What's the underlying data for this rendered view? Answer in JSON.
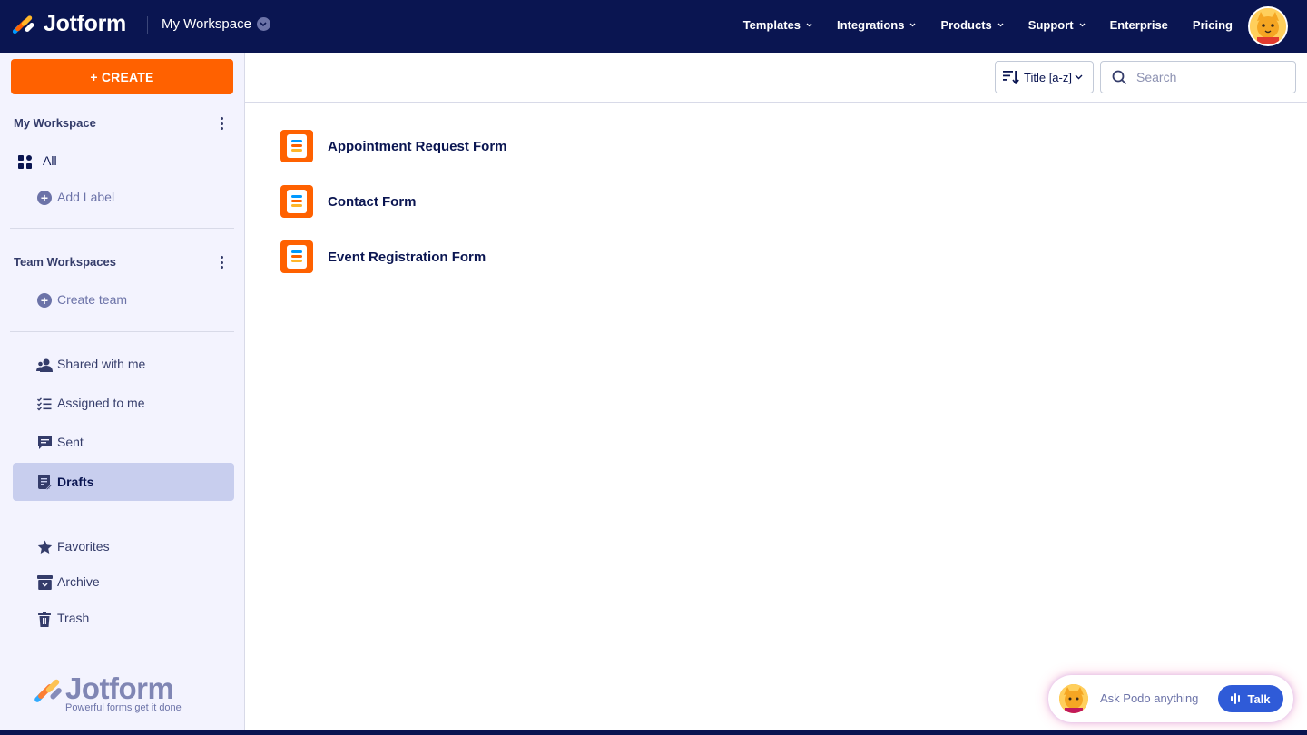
{
  "brand": {
    "name": "Jotform",
    "tagline": "Powerful forms get it done"
  },
  "header": {
    "workspace_switch": "My Workspace",
    "nav": [
      {
        "label": "Templates",
        "has_menu": true
      },
      {
        "label": "Integrations",
        "has_menu": true
      },
      {
        "label": "Products",
        "has_menu": true
      },
      {
        "label": "Support",
        "has_menu": true
      },
      {
        "label": "Enterprise",
        "has_menu": false
      },
      {
        "label": "Pricing",
        "has_menu": false
      }
    ]
  },
  "sidebar": {
    "create_label": "+ CREATE",
    "my_workspace": {
      "title": "My Workspace",
      "items": [
        {
          "label": "All",
          "icon": "grid-icon"
        },
        {
          "label": "Add Label",
          "icon": "plus-circle-icon"
        }
      ]
    },
    "team_workspaces": {
      "title": "Team Workspaces",
      "items": [
        {
          "label": "Create team",
          "icon": "plus-circle-icon"
        }
      ]
    },
    "shared": [
      {
        "label": "Shared with me",
        "icon": "users-icon"
      },
      {
        "label": "Assigned to me",
        "icon": "checklist-icon"
      },
      {
        "label": "Sent",
        "icon": "message-icon"
      },
      {
        "label": "Drafts",
        "icon": "draft-icon",
        "active": true
      }
    ],
    "misc": [
      {
        "label": "Favorites",
        "icon": "star-icon"
      },
      {
        "label": "Archive",
        "icon": "archive-icon"
      },
      {
        "label": "Trash",
        "icon": "trash-icon"
      }
    ]
  },
  "toolbar": {
    "sort_label": "Title [a-z]",
    "search_placeholder": "Search"
  },
  "forms": [
    {
      "title": "Appointment Request Form"
    },
    {
      "title": "Contact Form"
    },
    {
      "title": "Event Registration Form"
    }
  ],
  "assistant": {
    "prompt": "Ask Podo anything",
    "talk_label": "Talk"
  },
  "colors": {
    "navy": "#0a1551",
    "orange": "#ff6100",
    "sidebar_bg": "#f3f3fe",
    "active_bg": "#c8ceee",
    "talk_blue": "#2f5bd8"
  }
}
